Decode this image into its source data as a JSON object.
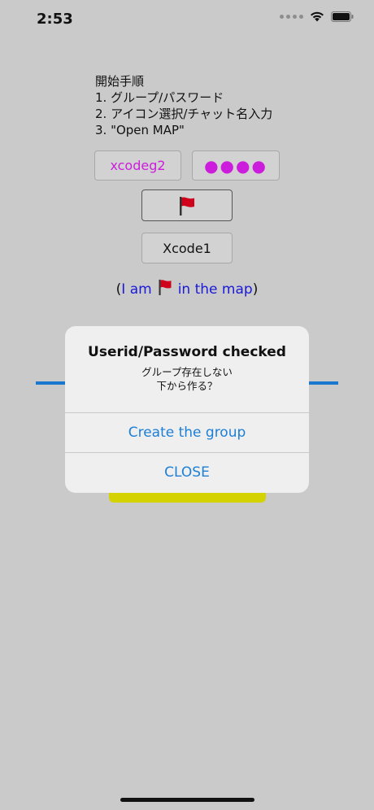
{
  "status_bar": {
    "time": "2:53",
    "icons": [
      "signal-dots-icon",
      "wifi-icon",
      "battery-icon"
    ]
  },
  "instructions": {
    "heading": "開始手順",
    "step1": "1. グループ/パスワード",
    "step2": "2. アイコン選択/チャット名入力",
    "step3": "3. \"Open MAP\""
  },
  "form": {
    "group_value": "xcodeg2",
    "password_value": "●●●●",
    "icon": "red-flag-icon",
    "chat_name": "Xcode1"
  },
  "map_status": {
    "open_paren": "(",
    "prefix": "I am",
    "icon": "red-flag-icon",
    "suffix": "in the map",
    "close_paren": ")"
  },
  "alert": {
    "title": "Userid/Password checked",
    "message_line1": "グループ存在しない",
    "message_line2": "下から作る？",
    "create_label": "Create the group",
    "close_label": "CLOSE"
  },
  "colors": {
    "background": "#cacaca",
    "accent_blue": "#1d7fd6",
    "magenta_text": "#cc1ddd",
    "flag_red": "#d0021b",
    "yellow_button": "#d4d200"
  }
}
